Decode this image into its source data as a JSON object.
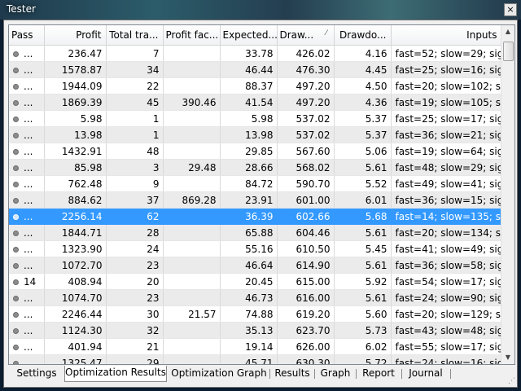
{
  "window": {
    "title": "Tester",
    "close_glyph": "×"
  },
  "columns": [
    "Pass",
    "Profit",
    "Total tra...",
    "Profit fac...",
    "Expected...",
    "Draw...",
    "Drawdo...",
    "Inputs"
  ],
  "sort_indicator": "⁄",
  "rows": [
    {
      "pass": "...",
      "profit": "236.47",
      "trades": "7",
      "pf": "",
      "expected": "33.78",
      "draw": "426.02",
      "drawdown": "4.16",
      "inputs": "fast=52; slow=29; sign=..."
    },
    {
      "pass": "...",
      "profit": "1578.87",
      "trades": "34",
      "pf": "",
      "expected": "46.44",
      "draw": "476.30",
      "drawdown": "4.45",
      "inputs": "fast=25; slow=16; sign=..."
    },
    {
      "pass": "...",
      "profit": "1944.09",
      "trades": "22",
      "pf": "",
      "expected": "88.37",
      "draw": "497.20",
      "drawdown": "4.50",
      "inputs": "fast=20; slow=102; sign=..."
    },
    {
      "pass": "...",
      "profit": "1869.39",
      "trades": "45",
      "pf": "390.46",
      "expected": "41.54",
      "draw": "497.20",
      "drawdown": "4.36",
      "inputs": "fast=19; slow=105; sign=..."
    },
    {
      "pass": "...",
      "profit": "5.98",
      "trades": "1",
      "pf": "",
      "expected": "5.98",
      "draw": "537.02",
      "drawdown": "5.37",
      "inputs": "fast=25; slow=17; sign=..."
    },
    {
      "pass": "...",
      "profit": "13.98",
      "trades": "1",
      "pf": "",
      "expected": "13.98",
      "draw": "537.02",
      "drawdown": "5.37",
      "inputs": "fast=36; slow=21; sign=..."
    },
    {
      "pass": "...",
      "profit": "1432.91",
      "trades": "48",
      "pf": "",
      "expected": "29.85",
      "draw": "567.60",
      "drawdown": "5.06",
      "inputs": "fast=19; slow=64; sign=..."
    },
    {
      "pass": "...",
      "profit": "85.98",
      "trades": "3",
      "pf": "29.48",
      "expected": "28.66",
      "draw": "568.02",
      "drawdown": "5.61",
      "inputs": "fast=48; slow=29; sign=..."
    },
    {
      "pass": "...",
      "profit": "762.48",
      "trades": "9",
      "pf": "",
      "expected": "84.72",
      "draw": "590.70",
      "drawdown": "5.52",
      "inputs": "fast=49; slow=41; sign=..."
    },
    {
      "pass": "...",
      "profit": "884.62",
      "trades": "37",
      "pf": "869.28",
      "expected": "23.91",
      "draw": "601.00",
      "drawdown": "6.01",
      "inputs": "fast=36; slow=15; sign=..."
    },
    {
      "pass": "...",
      "profit": "2256.14",
      "trades": "62",
      "pf": "",
      "expected": "36.39",
      "draw": "602.66",
      "drawdown": "5.68",
      "inputs": "fast=14; slow=135; sign=...",
      "selected": true
    },
    {
      "pass": "...",
      "profit": "1844.71",
      "trades": "28",
      "pf": "",
      "expected": "65.88",
      "draw": "604.46",
      "drawdown": "5.61",
      "inputs": "fast=20; slow=134; sign=..."
    },
    {
      "pass": "...",
      "profit": "1323.90",
      "trades": "24",
      "pf": "",
      "expected": "55.16",
      "draw": "610.50",
      "drawdown": "5.45",
      "inputs": "fast=41; slow=49; sign=..."
    },
    {
      "pass": "...",
      "profit": "1072.70",
      "trades": "23",
      "pf": "",
      "expected": "46.64",
      "draw": "614.90",
      "drawdown": "5.61",
      "inputs": "fast=36; slow=58; sign=..."
    },
    {
      "pass": "14",
      "profit": "408.94",
      "trades": "20",
      "pf": "",
      "expected": "20.45",
      "draw": "615.00",
      "drawdown": "5.92",
      "inputs": "fast=54; slow=17; sign=..."
    },
    {
      "pass": "...",
      "profit": "1074.70",
      "trades": "23",
      "pf": "",
      "expected": "46.73",
      "draw": "616.00",
      "drawdown": "5.61",
      "inputs": "fast=24; slow=90; sign=..."
    },
    {
      "pass": "...",
      "profit": "2246.44",
      "trades": "30",
      "pf": "21.57",
      "expected": "74.88",
      "draw": "619.20",
      "drawdown": "5.60",
      "inputs": "fast=20; slow=129; sign=..."
    },
    {
      "pass": "...",
      "profit": "1124.30",
      "trades": "32",
      "pf": "",
      "expected": "35.13",
      "draw": "623.70",
      "drawdown": "5.73",
      "inputs": "fast=43; slow=48; sign=..."
    },
    {
      "pass": "...",
      "profit": "401.94",
      "trades": "21",
      "pf": "",
      "expected": "19.14",
      "draw": "626.00",
      "drawdown": "6.02",
      "inputs": "fast=55; slow=17; sign=..."
    },
    {
      "pass": "...",
      "profit": "1325.47",
      "trades": "29",
      "pf": "",
      "expected": "45.71",
      "draw": "630.30",
      "drawdown": "5.72",
      "inputs": "fast=24; slow=16; sign=..."
    }
  ],
  "tabs": [
    "Settings",
    "Optimization Results",
    "Optimization Graph",
    "Results",
    "Graph",
    "Report",
    "Journal"
  ],
  "active_tab": "Optimization Results",
  "colors": {
    "selection": "#3399ff",
    "alt_row": "#ebebeb"
  }
}
